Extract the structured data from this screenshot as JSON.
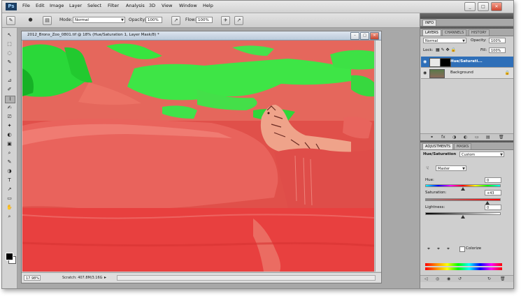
{
  "menubar": {
    "logo": "Ps",
    "items": [
      "File",
      "Edit",
      "Image",
      "Layer",
      "Select",
      "Filter",
      "Analysis",
      "3D",
      "View",
      "Window",
      "Help"
    ],
    "window_buttons": [
      "_",
      "□",
      "✕"
    ]
  },
  "options_bar": {
    "mode_label": "Mode:",
    "mode_value": "Normal",
    "opacity_label": "Opacity:",
    "opacity_value": "100%",
    "flow_label": "Flow:",
    "flow_value": "100%"
  },
  "tools": [
    "↖",
    "⬚",
    "◌",
    "✎",
    "⌖",
    "⊿",
    "✐",
    "⌇",
    "✍",
    "⎚",
    "✦",
    "◐",
    "▣",
    "⌕",
    "✎",
    "◑",
    "T",
    "↗",
    "▭",
    "✋",
    "⌕"
  ],
  "document": {
    "title": "2012_Bronx_Zoo_0801.tif @ 18% (Hue/Saturation 1, Layer Mask/8) *",
    "buttons": [
      "–",
      "□",
      "✕"
    ],
    "zoom": "17.98%",
    "scratch": "Scratch: 407.8M/3.16G",
    "arrow": "▸"
  },
  "panels": {
    "info_tab": "INFO",
    "layers_tabs": [
      "LAYERS",
      "CHANNELS",
      "HISTORY"
    ],
    "blend_mode": "Normal",
    "opacity_label": "Opacity:",
    "opacity_value": "100%",
    "lock_label": "Lock:",
    "fill_label": "Fill:",
    "fill_value": "100%",
    "layers": [
      {
        "name": "Hue/Saturati...",
        "selected": true
      },
      {
        "name": "Background",
        "selected": false
      }
    ],
    "layers_footer_icons": [
      "⚭",
      "fx",
      "◑",
      "◐",
      "▭",
      "▤",
      "🗑"
    ],
    "adjustments_tabs": [
      "ADJUSTMENTS",
      "MASKS"
    ],
    "adj_title": "Hue/Saturation",
    "preset_value": "Custom",
    "channel_value": "Master",
    "hue_label": "Hue:",
    "hue_value": "0",
    "saturation_label": "Saturation:",
    "saturation_value": "+43",
    "lightness_label": "Lightness:",
    "lightness_value": "0",
    "colorize_label": "Colorize",
    "adj_footer_icons": [
      "◁",
      "◎",
      "◉",
      "↺",
      "↻",
      "🗑"
    ]
  },
  "colors": {
    "overlay_red": "#e84a47",
    "foliage_green": "#2fe33b",
    "selection_blue": "#2f6fb8"
  }
}
